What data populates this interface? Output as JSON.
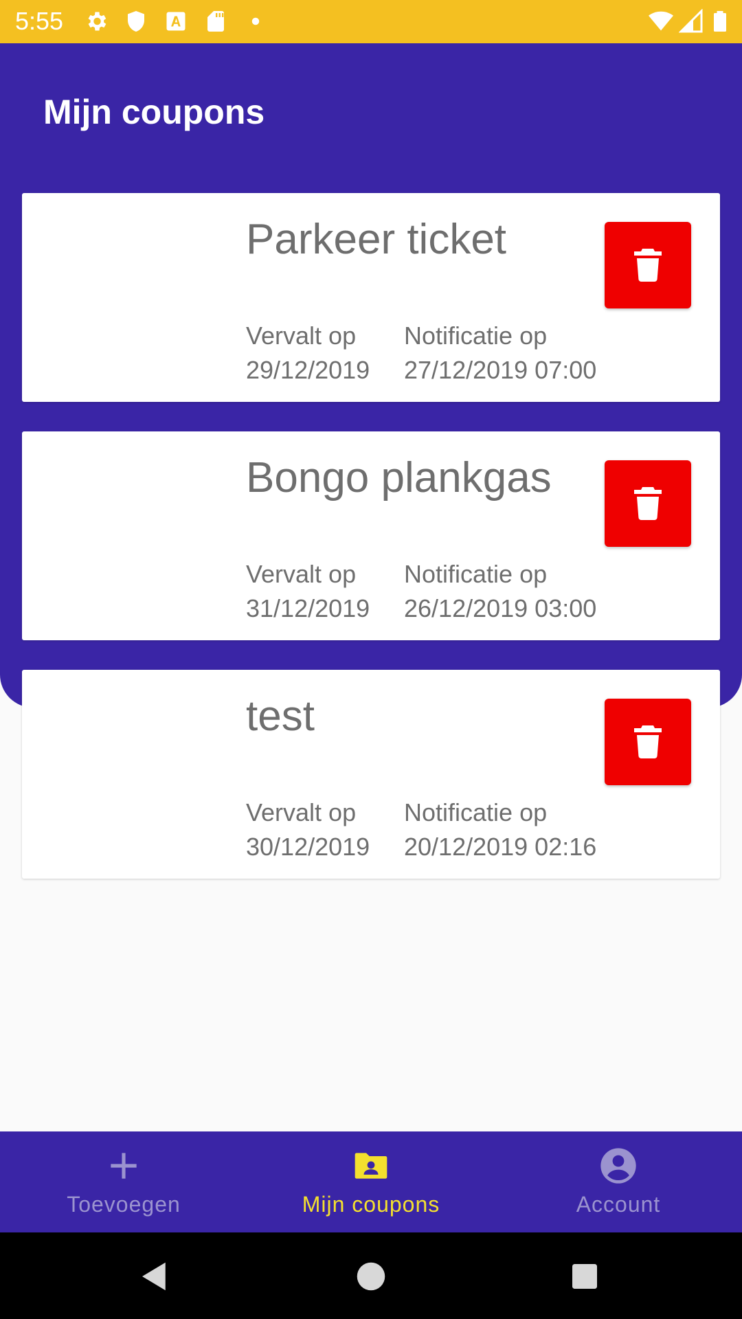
{
  "status_bar": {
    "time": "5:55",
    "bg_color": "#f4c021",
    "icons": [
      "gear-icon",
      "shield-icon",
      "a-box-icon",
      "sd-card-icon",
      "dot-icon",
      "wifi-icon",
      "signal-icon",
      "battery-icon"
    ]
  },
  "page": {
    "title": "Mijn coupons",
    "header_color": "#3a25a6"
  },
  "coupons": [
    {
      "title": "Parkeer ticket",
      "expires_label": "Vervalt op",
      "expires_value": "29/12/2019",
      "notify_label": "Notificatie op",
      "notify_value": "27/12/2019 07:00"
    },
    {
      "title": "Bongo plankgas",
      "expires_label": "Vervalt op",
      "expires_value": "31/12/2019",
      "notify_label": "Notificatie op",
      "notify_value": "26/12/2019 03:00"
    },
    {
      "title": "test",
      "expires_label": "Vervalt op",
      "expires_value": "30/12/2019",
      "notify_label": "Notificatie op",
      "notify_value": "20/12/2019 02:16"
    }
  ],
  "delete_button": {
    "icon": "trash-icon",
    "color": "#ef0000"
  },
  "bottom_nav": {
    "items": [
      {
        "label": "Toevoegen",
        "icon": "plus-icon",
        "active": false
      },
      {
        "label": "Mijn coupons",
        "icon": "folder-user-icon",
        "active": true
      },
      {
        "label": "Account",
        "icon": "account-circle-icon",
        "active": false
      }
    ],
    "active_color": "#f4e02e",
    "inactive_color": "#9b93cf"
  },
  "system_nav": {
    "buttons": [
      "back-icon",
      "home-icon",
      "recents-icon"
    ]
  }
}
